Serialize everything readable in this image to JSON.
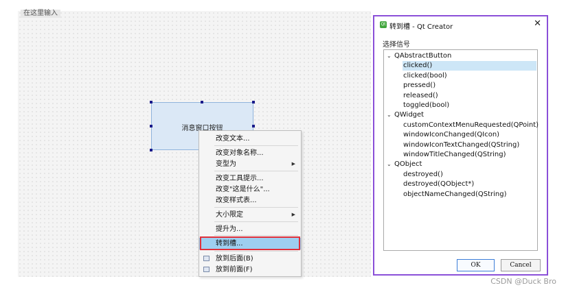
{
  "canvas": {
    "top_hint": "在这里输入"
  },
  "widget": {
    "button_text": "消息窗口按钮"
  },
  "context_menu": {
    "items": [
      {
        "label": "改变文本...",
        "submenu": false
      },
      {
        "label": "改变对象名称...",
        "submenu": false
      },
      {
        "label": "变型为",
        "submenu": true
      },
      {
        "label": "改变工具提示...",
        "submenu": false
      },
      {
        "label": "改变\"这是什么\"...",
        "submenu": false
      },
      {
        "label": "改变样式表...",
        "submenu": false
      },
      {
        "label": "大小限定",
        "submenu": true
      },
      {
        "label": "提升为...",
        "submenu": false
      },
      {
        "label": "转到槽...",
        "submenu": false,
        "highlighted": true
      },
      {
        "label": "放到后面(B)",
        "submenu": false
      },
      {
        "label": "放到前面(F)",
        "submenu": false
      }
    ]
  },
  "dialog": {
    "icon_text": "Qt",
    "title": "转到槽 - Qt Creator",
    "section_label": "选择信号",
    "groups": [
      {
        "name": "QAbstractButton",
        "signals": [
          "clicked()",
          "clicked(bool)",
          "pressed()",
          "released()",
          "toggled(bool)"
        ]
      },
      {
        "name": "QWidget",
        "signals": [
          "customContextMenuRequested(QPoint)",
          "windowIconChanged(QIcon)",
          "windowIconTextChanged(QString)",
          "windowTitleChanged(QString)"
        ]
      },
      {
        "name": "QObject",
        "signals": [
          "destroyed()",
          "destroyed(QObject*)",
          "objectNameChanged(QString)"
        ]
      }
    ],
    "selected_signal": "clicked()",
    "ok_label": "OK",
    "cancel_label": "Cancel",
    "close_glyph": "✕"
  },
  "watermark": "CSDN @Duck Bro"
}
